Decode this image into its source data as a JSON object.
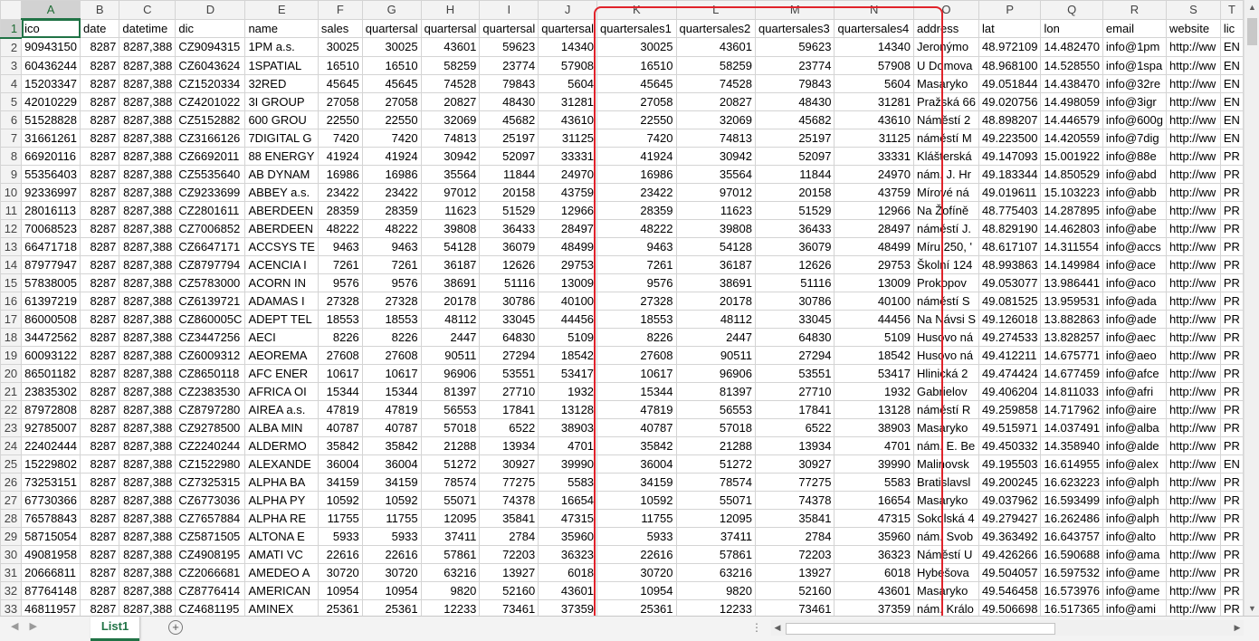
{
  "sheet": {
    "tab_name": "List1",
    "active_cell": "A1",
    "columns": [
      {
        "letter": "A",
        "width": 61
      },
      {
        "letter": "B",
        "width": 63
      },
      {
        "letter": "C",
        "width": 64
      },
      {
        "letter": "D",
        "width": 64
      },
      {
        "letter": "E",
        "width": 63
      },
      {
        "letter": "F",
        "width": 64
      },
      {
        "letter": "G",
        "width": 64
      },
      {
        "letter": "H",
        "width": 64
      },
      {
        "letter": "I",
        "width": 64
      },
      {
        "letter": "J",
        "width": 64
      },
      {
        "letter": "K",
        "width": 92
      },
      {
        "letter": "L",
        "width": 92
      },
      {
        "letter": "M",
        "width": 92
      },
      {
        "letter": "N",
        "width": 92
      },
      {
        "letter": "O",
        "width": 64
      },
      {
        "letter": "P",
        "width": 64
      },
      {
        "letter": "Q",
        "width": 64
      },
      {
        "letter": "R",
        "width": 64
      },
      {
        "letter": "S",
        "width": 64
      },
      {
        "letter": "T",
        "width": 20
      }
    ],
    "rows": [
      [
        "ico",
        "date",
        "datetime",
        "dic",
        "name",
        "sales",
        "quartersal",
        "quartersal",
        "quartersal",
        "quartersal",
        "quartersales1",
        "quartersales2",
        "quartersales3",
        "quartersales4",
        "address",
        "lat",
        "lon",
        "email",
        "website",
        "lic"
      ],
      [
        "90943150",
        "8287",
        "8287,388",
        "CZ9094315",
        "1PM a.s.",
        "30025",
        "30025",
        "43601",
        "59623",
        "14340",
        "30025",
        "43601",
        "59623",
        "14340",
        "Jeronýmo",
        "48.972109",
        "14.482470",
        "info@1pm",
        "http://ww",
        "EN"
      ],
      [
        "60436244",
        "8287",
        "8287,388",
        "CZ6043624",
        "1SPATIAL",
        "16510",
        "16510",
        "58259",
        "23774",
        "57908",
        "16510",
        "58259",
        "23774",
        "57908",
        "U Domova",
        "48.968100",
        "14.528550",
        "info@1spa",
        "http://ww",
        "EN"
      ],
      [
        "15203347",
        "8287",
        "8287,388",
        "CZ1520334",
        "32RED",
        "45645",
        "45645",
        "74528",
        "79843",
        "5604",
        "45645",
        "74528",
        "79843",
        "5604",
        "Masaryko",
        "49.051844",
        "14.438470",
        "info@32re",
        "http://ww",
        "EN"
      ],
      [
        "42010229",
        "8287",
        "8287,388",
        "CZ4201022",
        "3I GROUP",
        "27058",
        "27058",
        "20827",
        "48430",
        "31281",
        "27058",
        "20827",
        "48430",
        "31281",
        "Pražská 66",
        "49.020756",
        "14.498059",
        "info@3igr",
        "http://ww",
        "EN"
      ],
      [
        "51528828",
        "8287",
        "8287,388",
        "CZ5152882",
        "600 GROU",
        "22550",
        "22550",
        "32069",
        "45682",
        "43610",
        "22550",
        "32069",
        "45682",
        "43610",
        "Náměstí 2",
        "48.898207",
        "14.446579",
        "info@600g",
        "http://ww",
        "EN"
      ],
      [
        "31661261",
        "8287",
        "8287,388",
        "CZ3166126",
        "7DIGITAL G",
        "7420",
        "7420",
        "74813",
        "25197",
        "31125",
        "7420",
        "74813",
        "25197",
        "31125",
        "náměstí M",
        "49.223500",
        "14.420559",
        "info@7dig",
        "http://ww",
        "EN"
      ],
      [
        "66920116",
        "8287",
        "8287,388",
        "CZ6692011",
        "88 ENERGY",
        "41924",
        "41924",
        "30942",
        "52097",
        "33331",
        "41924",
        "30942",
        "52097",
        "33331",
        "Klášterská",
        "49.147093",
        "15.001922",
        "info@88e",
        "http://ww",
        "PR"
      ],
      [
        "55356403",
        "8287",
        "8287,388",
        "CZ5535640",
        "AB DYNAM",
        "16986",
        "16986",
        "35564",
        "11844",
        "24970",
        "16986",
        "35564",
        "11844",
        "24970",
        "nám. J. Hr",
        "49.183344",
        "14.850529",
        "info@abd",
        "http://ww",
        "PR"
      ],
      [
        "92336997",
        "8287",
        "8287,388",
        "CZ9233699",
        "ABBEY a.s.",
        "23422",
        "23422",
        "97012",
        "20158",
        "43759",
        "23422",
        "97012",
        "20158",
        "43759",
        "Mírové ná",
        "49.019611",
        "15.103223",
        "info@abb",
        "http://ww",
        "PR"
      ],
      [
        "28016113",
        "8287",
        "8287,388",
        "CZ2801611",
        "ABERDEEN",
        "28359",
        "28359",
        "11623",
        "51529",
        "12966",
        "28359",
        "11623",
        "51529",
        "12966",
        "Na Žofíně",
        "48.775403",
        "14.287895",
        "info@abe",
        "http://ww",
        "PR"
      ],
      [
        "70068523",
        "8287",
        "8287,388",
        "CZ7006852",
        "ABERDEEN",
        "48222",
        "48222",
        "39808",
        "36433",
        "28497",
        "48222",
        "39808",
        "36433",
        "28497",
        "náměstí J.",
        "48.829190",
        "14.462803",
        "info@abe",
        "http://ww",
        "PR"
      ],
      [
        "66471718",
        "8287",
        "8287,388",
        "CZ6647171",
        "ACCSYS TE",
        "9463",
        "9463",
        "54128",
        "36079",
        "48499",
        "9463",
        "54128",
        "36079",
        "48499",
        "Míru 250, '",
        "48.617107",
        "14.311554",
        "info@accs",
        "http://ww",
        "PR"
      ],
      [
        "87977947",
        "8287",
        "8287,388",
        "CZ8797794",
        "ACENCIA I",
        "7261",
        "7261",
        "36187",
        "12626",
        "29753",
        "7261",
        "36187",
        "12626",
        "29753",
        "Školní 124",
        "48.993863",
        "14.149984",
        "info@ace",
        "http://ww",
        "PR"
      ],
      [
        "57838005",
        "8287",
        "8287,388",
        "CZ5783000",
        "ACORN IN",
        "9576",
        "9576",
        "38691",
        "51116",
        "13009",
        "9576",
        "38691",
        "51116",
        "13009",
        "Prokopov",
        "49.053077",
        "13.986441",
        "info@aco",
        "http://ww",
        "PR"
      ],
      [
        "61397219",
        "8287",
        "8287,388",
        "CZ6139721",
        "ADAMAS I",
        "27328",
        "27328",
        "20178",
        "30786",
        "40100",
        "27328",
        "20178",
        "30786",
        "40100",
        "náměstí S",
        "49.081525",
        "13.959531",
        "info@ada",
        "http://ww",
        "PR"
      ],
      [
        "86000508",
        "8287",
        "8287,388",
        "CZ860005C",
        "ADEPT TEL",
        "18553",
        "18553",
        "48112",
        "33045",
        "44456",
        "18553",
        "48112",
        "33045",
        "44456",
        "Na Návsi S",
        "49.126018",
        "13.882863",
        "info@ade",
        "http://ww",
        "PR"
      ],
      [
        "34472562",
        "8287",
        "8287,388",
        "CZ3447256",
        "AECI",
        "8226",
        "8226",
        "2447",
        "64830",
        "5109",
        "8226",
        "2447",
        "64830",
        "5109",
        "Husovo ná",
        "49.274533",
        "13.828257",
        "info@aec",
        "http://ww",
        "PR"
      ],
      [
        "60093122",
        "8287",
        "8287,388",
        "CZ6009312",
        "AEOREMA",
        "27608",
        "27608",
        "90511",
        "27294",
        "18542",
        "27608",
        "90511",
        "27294",
        "18542",
        "Husovo ná",
        "49.412211",
        "14.675771",
        "info@aeo",
        "http://ww",
        "PR"
      ],
      [
        "86501182",
        "8287",
        "8287,388",
        "CZ8650118",
        "AFC ENER",
        "10617",
        "10617",
        "96906",
        "53551",
        "53417",
        "10617",
        "96906",
        "53551",
        "53417",
        "Hlinická 2",
        "49.474424",
        "14.677459",
        "info@afce",
        "http://ww",
        "PR"
      ],
      [
        "23835302",
        "8287",
        "8287,388",
        "CZ2383530",
        "AFRICA OI",
        "15344",
        "15344",
        "81397",
        "27710",
        "1932",
        "15344",
        "81397",
        "27710",
        "1932",
        "Gabrielov",
        "49.406204",
        "14.811033",
        "info@afri",
        "http://ww",
        "PR"
      ],
      [
        "87972808",
        "8287",
        "8287,388",
        "CZ8797280",
        "AIREA a.s.",
        "47819",
        "47819",
        "56553",
        "17841",
        "13128",
        "47819",
        "56553",
        "17841",
        "13128",
        "náměstí R",
        "49.259858",
        "14.717962",
        "info@aire",
        "http://ww",
        "PR"
      ],
      [
        "92785007",
        "8287",
        "8287,388",
        "CZ9278500",
        "ALBA MIN",
        "40787",
        "40787",
        "57018",
        "6522",
        "38903",
        "40787",
        "57018",
        "6522",
        "38903",
        "Masaryko",
        "49.515971",
        "14.037491",
        "info@alba",
        "http://ww",
        "PR"
      ],
      [
        "22402444",
        "8287",
        "8287,388",
        "CZ2240244",
        "ALDERMO",
        "35842",
        "35842",
        "21288",
        "13934",
        "4701",
        "35842",
        "21288",
        "13934",
        "4701",
        "nám. E. Be",
        "49.450332",
        "14.358940",
        "info@alde",
        "http://ww",
        "PR"
      ],
      [
        "15229802",
        "8287",
        "8287,388",
        "CZ1522980",
        "ALEXANDE",
        "36004",
        "36004",
        "51272",
        "30927",
        "39990",
        "36004",
        "51272",
        "30927",
        "39990",
        "Malinovsk",
        "49.195503",
        "16.614955",
        "info@alex",
        "http://ww",
        "EN"
      ],
      [
        "73253151",
        "8287",
        "8287,388",
        "CZ7325315",
        "ALPHA BA",
        "34159",
        "34159",
        "78574",
        "77275",
        "5583",
        "34159",
        "78574",
        "77275",
        "5583",
        "Bratislavsl",
        "49.200245",
        "16.623223",
        "info@alph",
        "http://ww",
        "PR"
      ],
      [
        "67730366",
        "8287",
        "8287,388",
        "CZ6773036",
        "ALPHA PY",
        "10592",
        "10592",
        "55071",
        "74378",
        "16654",
        "10592",
        "55071",
        "74378",
        "16654",
        "Masaryko",
        "49.037962",
        "16.593499",
        "info@alph",
        "http://ww",
        "PR"
      ],
      [
        "76578843",
        "8287",
        "8287,388",
        "CZ7657884",
        "ALPHA RE",
        "11755",
        "11755",
        "12095",
        "35841",
        "47315",
        "11755",
        "12095",
        "35841",
        "47315",
        "Sokolská 4",
        "49.279427",
        "16.262486",
        "info@alph",
        "http://ww",
        "PR"
      ],
      [
        "58715054",
        "8287",
        "8287,388",
        "CZ5871505",
        "ALTONA E",
        "5933",
        "5933",
        "37411",
        "2784",
        "35960",
        "5933",
        "37411",
        "2784",
        "35960",
        "nám. Svob",
        "49.363492",
        "16.643757",
        "info@alto",
        "http://ww",
        "PR"
      ],
      [
        "49081958",
        "8287",
        "8287,388",
        "CZ4908195",
        "AMATI VC",
        "22616",
        "22616",
        "57861",
        "72203",
        "36323",
        "22616",
        "57861",
        "72203",
        "36323",
        "Náměstí U",
        "49.426266",
        "16.590688",
        "info@ama",
        "http://ww",
        "PR"
      ],
      [
        "20666811",
        "8287",
        "8287,388",
        "CZ2066681",
        "AMEDEO A",
        "30720",
        "30720",
        "63216",
        "13927",
        "6018",
        "30720",
        "63216",
        "13927",
        "6018",
        "Hybešova",
        "49.504057",
        "16.597532",
        "info@ame",
        "http://ww",
        "PR"
      ],
      [
        "87764148",
        "8287",
        "8287,388",
        "CZ8776414",
        "AMERICAN",
        "10954",
        "10954",
        "9820",
        "52160",
        "43601",
        "10954",
        "9820",
        "52160",
        "43601",
        "Masaryko",
        "49.546458",
        "16.573976",
        "info@ame",
        "http://ww",
        "PR"
      ],
      [
        "46811957",
        "8287",
        "8287,388",
        "CZ4681195",
        "AMINEX",
        "25361",
        "25361",
        "12233",
        "73461",
        "37359",
        "25361",
        "12233",
        "73461",
        "37359",
        "nám. Králo",
        "49.506698",
        "16.517365",
        "info@ami",
        "http://ww",
        "PR"
      ]
    ],
    "text_columns": [
      0,
      3,
      4,
      14,
      15,
      16,
      17,
      18,
      19
    ],
    "numeric_columns": [
      1,
      2,
      5,
      6,
      7,
      8,
      9,
      10,
      11,
      12,
      13
    ]
  },
  "ui": {
    "add_sheet_label": "+",
    "more_dots": "⋮",
    "scroll_up": "▲",
    "scroll_down": "▼",
    "scroll_left": "◀",
    "scroll_right": "▶",
    "nav_prev": "◀",
    "nav_next": "▶"
  },
  "colors": {
    "accent": "#217346",
    "highlight_border": "#e0232b"
  }
}
